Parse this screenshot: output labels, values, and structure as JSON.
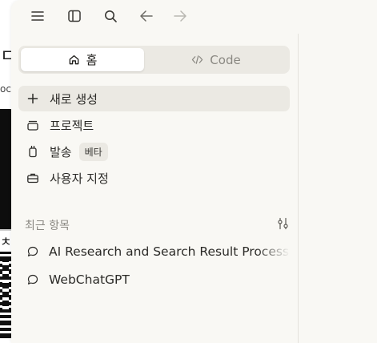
{
  "toolbar": {
    "icons": [
      "menu-icon",
      "sidebar-toggle-icon",
      "search-icon",
      "arrow-left-icon",
      "arrow-right-icon"
    ]
  },
  "mode_switch": {
    "home_label": "홈",
    "code_label": "Code"
  },
  "nav": {
    "new_label": "새로 생성",
    "projects_label": "프로젝트",
    "dispatch_label": "발송",
    "dispatch_badge": "베타",
    "customize_label": "사용자 지정"
  },
  "recents": {
    "label": "최근 항목",
    "items": [
      {
        "title": "AI Research and Search Result Processing"
      },
      {
        "title": "WebChatGPT"
      }
    ]
  },
  "colors": {
    "panel_bg": "#f9f8f4",
    "active_bg": "#ebe9e3",
    "text": "#2b2a27",
    "muted": "#8a8882"
  }
}
